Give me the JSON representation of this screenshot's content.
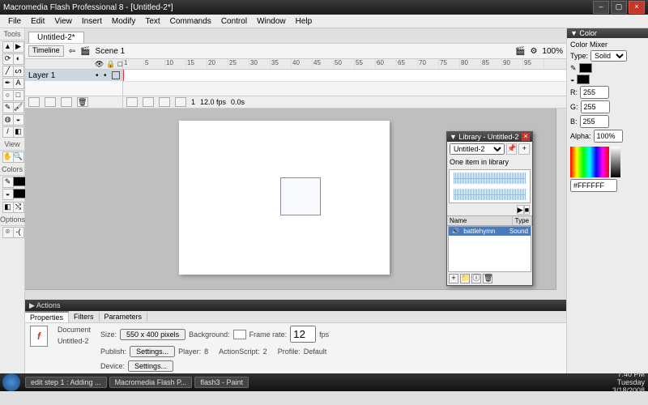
{
  "window": {
    "title": "Macromedia Flash Professional 8 - [Untitled-2*]"
  },
  "menu": [
    "File",
    "Edit",
    "View",
    "Insert",
    "Modify",
    "Text",
    "Commands",
    "Control",
    "Window",
    "Help"
  ],
  "document": {
    "tab": "Untitled-2*",
    "timeline_btn": "Timeline",
    "scene": "Scene 1",
    "zoom": "100%"
  },
  "timeline": {
    "layer": "Layer 1",
    "ruler": [
      "1",
      "5",
      "10",
      "15",
      "20",
      "25",
      "30",
      "35",
      "40",
      "45",
      "50",
      "55",
      "60",
      "65",
      "70",
      "75",
      "80",
      "85",
      "90",
      "95"
    ],
    "footer": {
      "frame": "1",
      "fps": "12.0 fps",
      "time": "0.0s"
    }
  },
  "tools_header": "Tools",
  "view_header": "View",
  "colors_header": "Colors",
  "options_header": "Options",
  "library": {
    "title": "▼ Library - Untitled-2",
    "doc": "Untitled-2",
    "msg": "One item in library",
    "col_name": "Name",
    "col_type": "Type",
    "item_name": "battlehymn",
    "item_type": "Sound"
  },
  "color_panel": {
    "title": "▼ Color",
    "mixer": "Color Mixer",
    "type_lbl": "Type:",
    "type_val": "Solid",
    "r_lbl": "R:",
    "r": "255",
    "g_lbl": "G:",
    "g": "255",
    "b_lbl": "B:",
    "b": "255",
    "a_lbl": "Alpha:",
    "a": "100%",
    "hex": "#FFFFFF"
  },
  "actions": {
    "label": "▶ Actions"
  },
  "prop_tabs": {
    "properties": "Properties",
    "filters": "Filters",
    "parameters": "Parameters"
  },
  "props": {
    "doc_lbl": "Document",
    "doc_name": "Untitled-2",
    "size_lbl": "Size:",
    "size_btn": "550 x 400 pixels",
    "bg_lbl": "Background:",
    "fr_lbl": "Frame rate:",
    "fr": "12",
    "fps": "fps",
    "pub_lbl": "Publish:",
    "pub_btn": "Settings...",
    "player_lbl": "Player:",
    "player": "8",
    "as_lbl": "ActionScript:",
    "as": "2",
    "prof_lbl": "Profile:",
    "prof": "Default",
    "dev_lbl": "Device:",
    "dev_btn": "Settings..."
  },
  "taskbar": {
    "t1": "edit step 1 : Adding ...",
    "t2": "Macromedia Flash P...",
    "t3": "flash3 - Paint",
    "time": "7:40 PM",
    "day": "Tuesday",
    "date": "3/18/2008"
  }
}
